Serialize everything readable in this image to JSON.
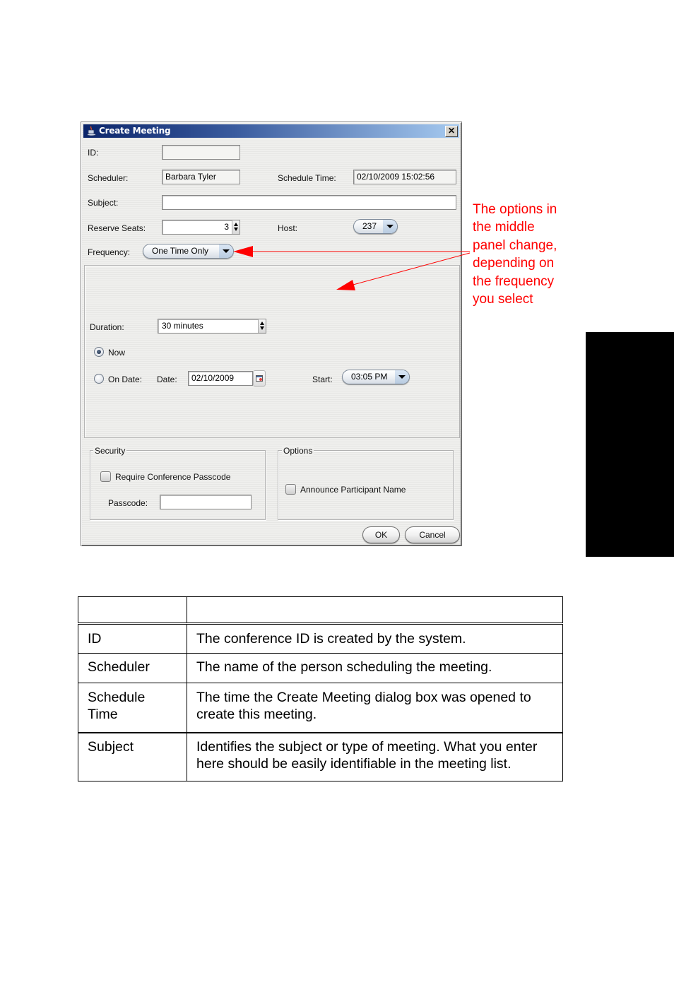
{
  "dialog": {
    "title": "Create Meeting",
    "close_glyph": "✕",
    "icons": {
      "title": "java-cup-icon",
      "close": "close-icon"
    },
    "fields": {
      "id": {
        "label": "ID:",
        "value": ""
      },
      "scheduler": {
        "label": "Scheduler:",
        "value": "Barbara Tyler"
      },
      "schedule_time": {
        "label": "Schedule Time:",
        "value": "02/10/2009 15:02:56"
      },
      "subject": {
        "label": "Subject:",
        "value": ""
      },
      "reserve_seats": {
        "label": "Reserve Seats:",
        "value": "3"
      },
      "host": {
        "label": "Host:",
        "value": "237"
      },
      "frequency": {
        "label": "Frequency:",
        "value": "One Time Only"
      }
    },
    "middle_panel": {
      "duration": {
        "label": "Duration:",
        "value": "30 minutes"
      },
      "now_radio": {
        "label": "Now",
        "checked": true
      },
      "on_date_radio": {
        "label": "On Date:",
        "checked": false
      },
      "date": {
        "label": "Date:",
        "value": "02/10/2009"
      },
      "start": {
        "label": "Start:",
        "value": "03:05 PM"
      }
    },
    "security": {
      "title": "Security",
      "require_passcode": {
        "label": "Require Conference Passcode",
        "checked": false
      },
      "passcode": {
        "label": "Passcode:",
        "value": ""
      }
    },
    "options": {
      "title": "Options",
      "announce_name": {
        "label": "Announce Participant Name",
        "checked": false
      }
    },
    "buttons": {
      "ok": "OK",
      "cancel": "Cancel"
    }
  },
  "annotation": {
    "text": "The options in the middle panel change, depending on the frequency you select",
    "lines": [
      "The options in",
      "the middle",
      "panel change,",
      "depending on",
      "the frequency",
      "you select"
    ],
    "color": "#ff0000"
  },
  "side_tab": {
    "color": "#000000"
  },
  "table": {
    "header": [
      "",
      ""
    ],
    "rows": [
      {
        "field": "ID",
        "description": "The conference ID is created by the system."
      },
      {
        "field": "Scheduler",
        "description": "The name of the person scheduling the meeting."
      },
      {
        "field": "Schedule Time",
        "description": "The time the Create Meeting dialog box was opened to create this meeting."
      },
      {
        "field": "Subject",
        "description": "Identifies the subject or type of meeting. What you enter here should be easily identifiable in the meeting list."
      }
    ]
  }
}
